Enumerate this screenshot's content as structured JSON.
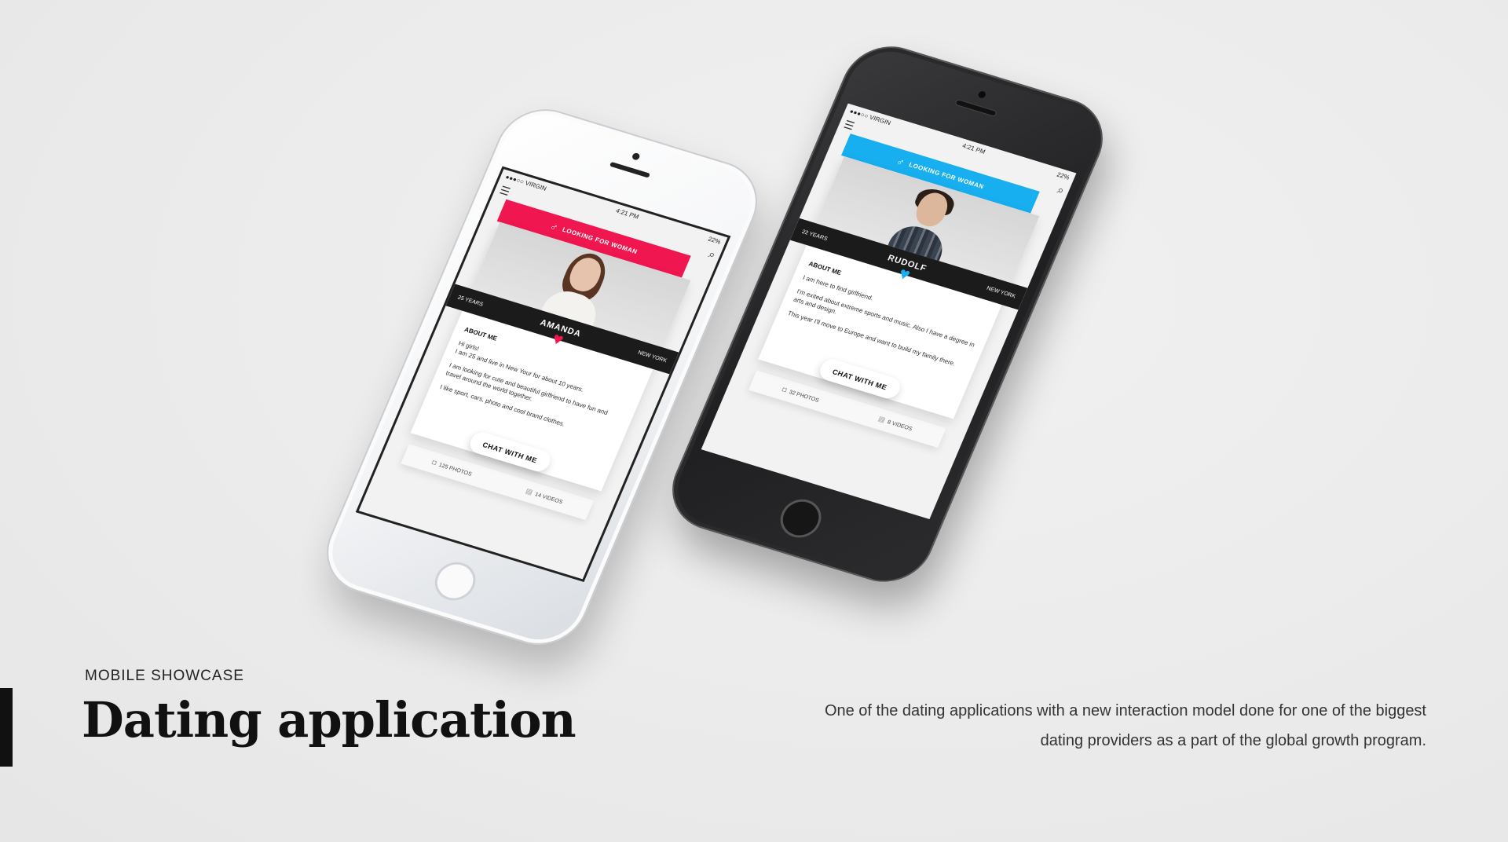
{
  "heading": {
    "eyebrow": "MOBILE SHOWCASE",
    "title": "Dating application",
    "description": "One of the dating applications with a new interaction model done for one of the biggest dating providers as a part of the global growth program."
  },
  "colors": {
    "pink": "#f0164f",
    "blue": "#17aff0"
  },
  "phones": [
    {
      "status": {
        "carrier": "●●●○○ VIRGIN",
        "time": "4:21 PM",
        "battery": "22%"
      },
      "looking_for": "LOOKING FOR WOMAN",
      "profile": {
        "age": "25 YEARS",
        "name": "AMANDA",
        "city": "NEW YORK",
        "about_title": "ABOUT ME",
        "about_lines": [
          "Hi girls!\nI am 25 and live in New Your for about 10 years.",
          "I am looking for cute and beautiful girlfriend to have fun and travel around the world together.",
          "I like sport, cars, photo and cool brand clothes."
        ],
        "chat_label": "CHAT WITH ME",
        "photos": "125 PHOTOS",
        "videos": "14 VIDEOS"
      }
    },
    {
      "status": {
        "carrier": "●●●○○ VIRGIN",
        "time": "4:21 PM",
        "battery": "22%"
      },
      "looking_for": "LOOKING FOR WOMAN",
      "profile": {
        "age": "22 YEARS",
        "name": "RUDOLF",
        "city": "NEW YORK",
        "about_title": "ABOUT ME",
        "about_lines": [
          "I am here to find girlfriend.",
          "I'm exited about extreme sports and music. Also I have a degree in arts and design.",
          "This year I'll move to Europe and want to build my family there."
        ],
        "chat_label": "CHAT WITH ME",
        "photos": "32 PHOTOS",
        "videos": "8 VIDEOS"
      }
    }
  ]
}
